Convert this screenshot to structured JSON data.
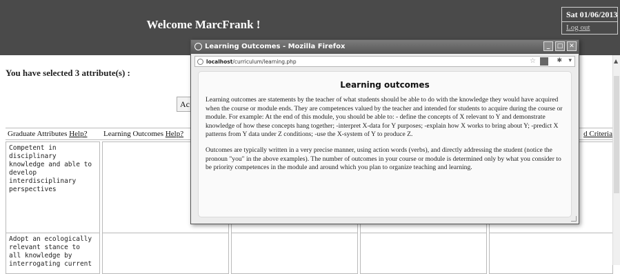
{
  "header": {
    "welcome": "Welcome MarcFrank !",
    "date": "Sat 01/06/2013",
    "logout": "Log out"
  },
  "main": {
    "selected_text": "You have selected 3 attribute(s) :",
    "action_button_partial": "Ac"
  },
  "table": {
    "headers": {
      "graduate_attributes": "Graduate Attributes",
      "learning_outcomes": "Learning Outcomes",
      "help": "Help?",
      "criteria_partial": "d Criteria"
    },
    "rows": [
      {
        "attribute": "Competent in\ndisciplinary\nknowledge and able to\ndevelop\ninterdisciplinary\nperspectives"
      },
      {
        "attribute": "Adopt an ecologically\nrelevant stance to\nall knowledge by\ninterrogating current"
      }
    ]
  },
  "popup": {
    "window_title": "Learning Outcomes - Mozilla Firefox",
    "url_host": "localhost",
    "url_path": "/curriculum/learning.php",
    "heading": "Learning outcomes",
    "paragraph1": "Learning outcomes are statements by the teacher of what students should be able to do with the knowledge they would have acquired when the course or module ends. They are competences valued by the teacher and intended for students to acquire during the course or module. For example: At the end of this module, you should be able to: - define the concepts of X relevant to Y and demonstrate knowledge of how these concepts hang together; -interpret X-data for Y purposes; -explain how X works to bring about Y; -predict X patterns from Y data under Z conditions; -use the X-system of Y to produce Z.",
    "paragraph2": "Outcomes are typically written in a very precise manner, using action words (verbs), and directly addressing the student (notice the pronoun \"you\" in the above examples). The number of outcomes in your course or module is determined only by what you consider to be priority competences in the module and around which you plan to organize teaching and learning."
  },
  "colors": {
    "header_bg": "#4a4a4a",
    "titlebar": "#606060"
  }
}
